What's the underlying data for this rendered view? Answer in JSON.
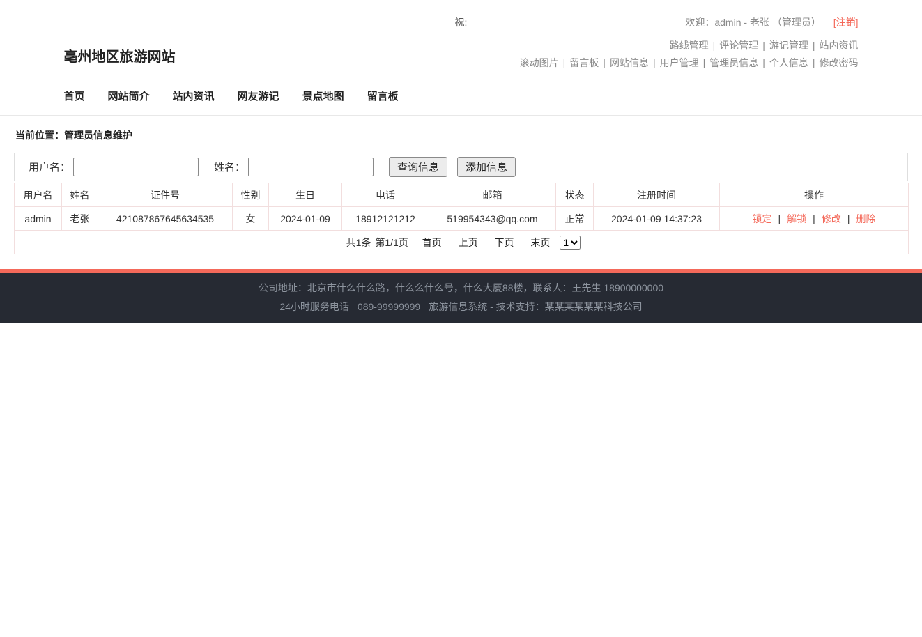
{
  "ui": {
    "separator": "|"
  },
  "colors": {
    "accent": "#f4695a",
    "footer_background": "#262a33",
    "footer_text": "#8d949e",
    "table_border": "#f2dede",
    "muted_text": "#8a8a8a"
  },
  "topbar": {
    "announcement": "祝:",
    "welcome": "欢迎：admin - 老张 （管理员）",
    "logout": "[注销]"
  },
  "header": {
    "site_title": "亳州地区旅游网站",
    "admin_links_row1": [
      "路线管理",
      "评论管理",
      "游记管理",
      "站内资讯"
    ],
    "admin_links_row2": [
      "滚动图片",
      "留言板",
      "网站信息",
      "用户管理",
      "管理员信息",
      "个人信息",
      "修改密码"
    ]
  },
  "nav": {
    "items": [
      "首页",
      "网站简介",
      "站内资讯",
      "网友游记",
      "景点地图",
      "留言板"
    ]
  },
  "breadcrumb": "当前位置：管理员信息维护",
  "search": {
    "username_label": "用户名：",
    "username_value": "",
    "name_label": "姓名：",
    "name_value": "",
    "query_button": "查询信息",
    "add_button": "添加信息"
  },
  "table": {
    "headers": [
      "用户名",
      "姓名",
      "证件号",
      "性别",
      "生日",
      "电话",
      "邮箱",
      "状态",
      "注册时间",
      "操作"
    ],
    "row": {
      "username": "admin",
      "name": "老张",
      "id_number": "421087867645634535",
      "gender": "女",
      "birthday": "2024-01-09",
      "phone": "18912121212",
      "email": "519954343@qq.com",
      "status": "正常",
      "register_time": "2024-01-09 14:37:23",
      "actions": [
        "锁定",
        "解锁",
        "修改",
        "删除"
      ]
    }
  },
  "pagination": {
    "total": "共1条",
    "page_info": "第1/1页",
    "first": "首页",
    "prev": "上页",
    "next": "下页",
    "last": "末页",
    "page_select": "1"
  },
  "footer": {
    "line1": "公司地址：北京市什么什么路，什么么什么号，什么大厦88楼，联系人：王先生 18900000000",
    "line2_service": "24小时服务电话",
    "line2_phone": "089-99999999",
    "line2_support": "旅游信息系统 - 技术支持：某某某某某某科技公司"
  }
}
